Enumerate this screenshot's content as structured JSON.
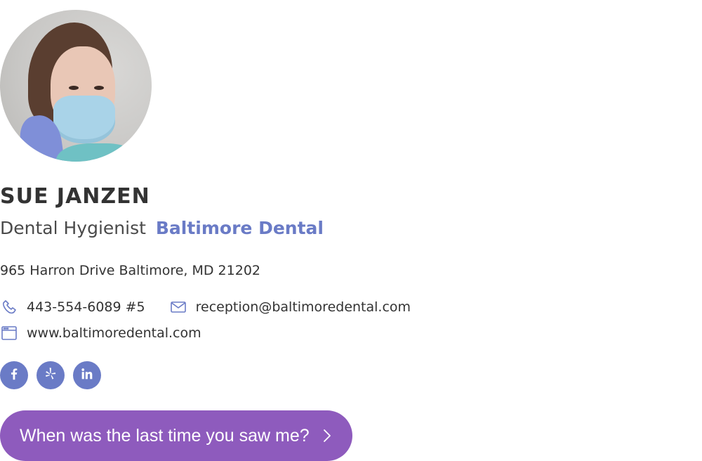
{
  "profile": {
    "name": "SUE JANZEN",
    "job_title": "Dental Hygienist",
    "company": "Baltimore Dental"
  },
  "address": "965 Harron Drive Baltimore, MD 21202",
  "contact": {
    "phone": "443-554-6089 #5",
    "email": "reception@baltimoredental.com",
    "website": "www.baltimoredental.com"
  },
  "icons": {
    "phone": "phone-icon",
    "email": "envelope-icon",
    "website": "browser-window-icon"
  },
  "social": [
    {
      "network": "facebook",
      "icon": "facebook-icon"
    },
    {
      "network": "yelp",
      "icon": "yelp-icon"
    },
    {
      "network": "linkedin",
      "icon": "linkedin-icon"
    }
  ],
  "cta": {
    "label": "When was the last time you saw me?"
  },
  "colors": {
    "accent": "#6a7bc6",
    "cta_background": "#8e5bbd",
    "text": "#333333"
  }
}
